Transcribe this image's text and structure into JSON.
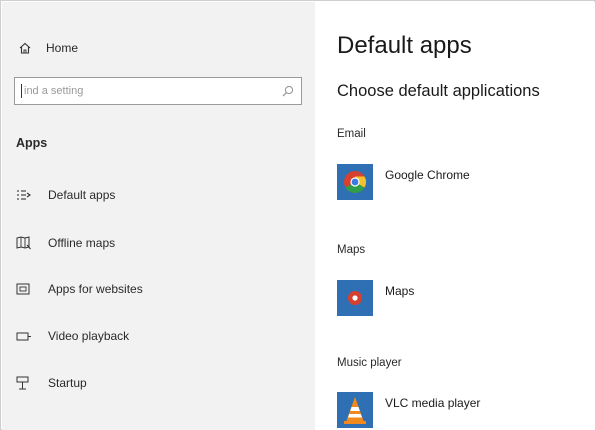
{
  "sidebar": {
    "home_label": "Home",
    "search_placeholder": "ind a setting",
    "section_title": "Apps",
    "items": [
      {
        "label": "Default apps"
      },
      {
        "label": "Offline maps"
      },
      {
        "label": "Apps for websites"
      },
      {
        "label": "Video playback"
      },
      {
        "label": "Startup"
      }
    ]
  },
  "main": {
    "title": "Default apps",
    "subtitle": "Choose default applications",
    "categories": [
      {
        "label": "Email",
        "app_name": "Google Chrome",
        "icon": "chrome-icon"
      },
      {
        "label": "Maps",
        "app_name": "Maps",
        "icon": "maps-icon"
      },
      {
        "label": "Music player",
        "app_name": "VLC media player",
        "icon": "vlc-icon"
      }
    ]
  },
  "colors": {
    "sidebar_bg": "#f2f2f2",
    "tile_blue": "#2f6fb3",
    "chrome_red": "#d6412f",
    "chrome_yellow": "#f2c12e",
    "chrome_green": "#2f9e4a",
    "vlc_orange": "#f08a1c"
  }
}
